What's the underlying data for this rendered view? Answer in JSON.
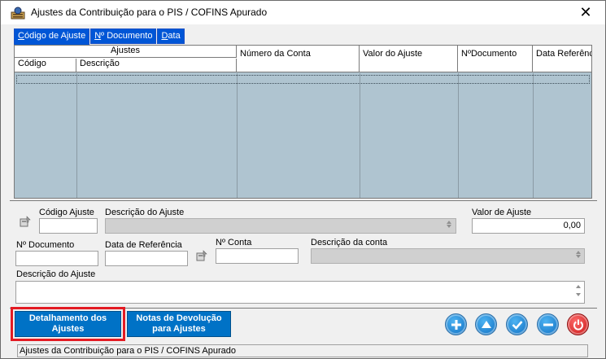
{
  "window": {
    "title": "Ajustes da Contribuição para o PIS / COFINS Apurado",
    "close_symbol": "✕"
  },
  "tabs": [
    {
      "label": "Código de Ajuste",
      "active": true
    },
    {
      "label": "Nº Documento",
      "active": false
    },
    {
      "label": "Data",
      "active": false
    }
  ],
  "grid": {
    "group_header": "Ajustes",
    "columns": [
      "Código",
      "Descrição",
      "Número da Conta",
      "Valor do Ajuste",
      "NºDocumento",
      "Data Referênc"
    ],
    "rows": []
  },
  "form": {
    "codigo_ajuste_label": "Código Ajuste",
    "codigo_ajuste_value": "",
    "descricao_ajuste_label": "Descrição do Ajuste",
    "descricao_ajuste_value": "",
    "valor_ajuste_label": "Valor de Ajuste",
    "valor_ajuste_value": "0,00",
    "n_documento_label": "Nº Documento",
    "n_documento_value": "",
    "data_referencia_label": "Data de Referência",
    "data_referencia_value": "",
    "n_conta_label": "Nº Conta",
    "n_conta_value": "",
    "descricao_conta_label": "Descrição da conta",
    "descricao_conta_value": "",
    "descricao_ajuste2_label": "Descrição do Ajuste",
    "descricao_ajuste2_value": ""
  },
  "buttons": {
    "detalhamento_line1": "Detalhamento dos",
    "detalhamento_line2": "Ajustes",
    "notas_line1": "Notas de Devolução",
    "notas_line2": "para Ajustes"
  },
  "actions": [
    "plus-icon",
    "up-arrow-icon",
    "check-icon",
    "minus-icon",
    "power-icon"
  ],
  "status": {
    "text": "Ajustes da Contribuição para o PIS / COFINS Apurado"
  },
  "colors": {
    "grid_body": "#afc4d0",
    "tab_blue": "#0056d6",
    "button_blue": "#0072c6",
    "highlight_red": "#e31b23"
  }
}
